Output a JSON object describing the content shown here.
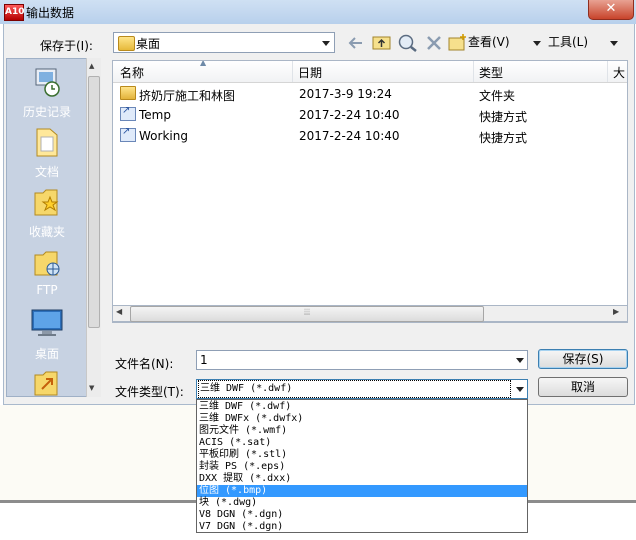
{
  "window": {
    "app_icon_text": "A10",
    "title": "输出数据",
    "close_glyph": "✕"
  },
  "toolbar": {
    "save_in_label": "保存于(I):",
    "location": "桌面",
    "view_label": "查看(V)",
    "tools_label": "工具(L)"
  },
  "places": [
    {
      "label": "历史记录",
      "icon": "history-icon"
    },
    {
      "label": "文档",
      "icon": "documents-icon"
    },
    {
      "label": "收藏夹",
      "icon": "favorites-icon"
    },
    {
      "label": "FTP",
      "icon": "ftp-icon"
    },
    {
      "label": "桌面",
      "icon": "desktop-icon"
    }
  ],
  "file_list": {
    "columns": [
      "名称",
      "日期",
      "类型",
      "大"
    ],
    "rows": [
      {
        "name": "挤奶厅施工和林图",
        "date": "2017-3-9 19:24",
        "type": "文件夹",
        "icon": "folder-icon"
      },
      {
        "name": "Temp",
        "date": "2017-2-24 10:40",
        "type": "快捷方式",
        "icon": "shortcut-icon"
      },
      {
        "name": "Working",
        "date": "2017-2-24 10:40",
        "type": "快捷方式",
        "icon": "shortcut-icon"
      }
    ],
    "hscroll_grip": "⦙⦙⦙"
  },
  "form": {
    "filename_label": "文件名(N):",
    "filename_value": "1",
    "filetype_label": "文件类型(T):",
    "filetype_value": "三维 DWF (*.dwf)",
    "save_label": "保存(S)",
    "cancel_label": "取消"
  },
  "dropdown": {
    "options": [
      "三维 DWF (*.dwf)",
      "三维 DWFx (*.dwfx)",
      "图元文件 (*.wmf)",
      "ACIS (*.sat)",
      "平板印刷 (*.stl)",
      "封装 PS (*.eps)",
      "DXX 提取 (*.dxx)",
      "位图 (*.bmp)",
      "块 (*.dwg)",
      "V8 DGN (*.dgn)",
      "V7 DGN (*.dgn)"
    ],
    "selected_index": 7
  },
  "colors": {
    "selection": "#3399ff",
    "places_bar": "#c7d2e2",
    "dialog_bg": "#f0f0f0"
  }
}
